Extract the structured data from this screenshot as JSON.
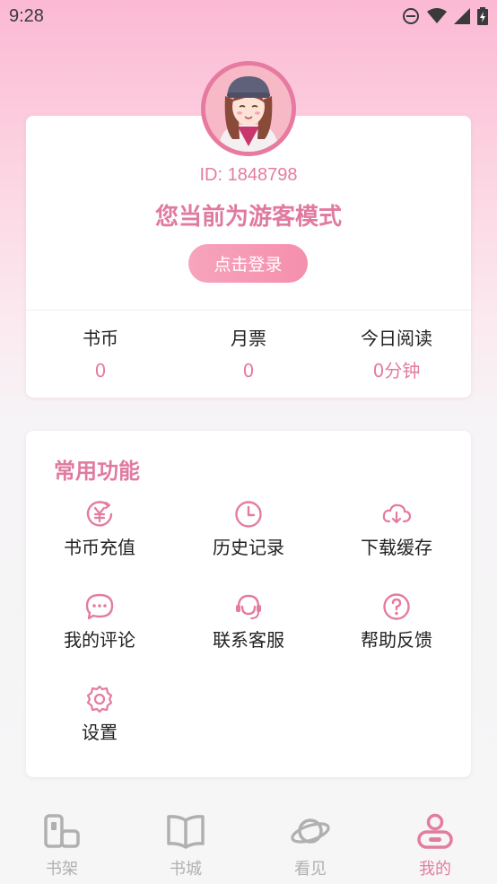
{
  "status_bar": {
    "time": "9:28"
  },
  "profile": {
    "user_id": "ID: 1848798",
    "guest_title": "您当前为游客模式",
    "login_button": "点击登录"
  },
  "stats": [
    {
      "label": "书币",
      "value": "0"
    },
    {
      "label": "月票",
      "value": "0"
    },
    {
      "label": "今日阅读",
      "value": "0分钟"
    }
  ],
  "functions": {
    "title": "常用功能",
    "items": [
      {
        "label": "书币充值",
        "icon": "coin-recharge-icon"
      },
      {
        "label": "历史记录",
        "icon": "clock-icon"
      },
      {
        "label": "下载缓存",
        "icon": "cloud-download-icon"
      },
      {
        "label": "我的评论",
        "icon": "comment-icon"
      },
      {
        "label": "联系客服",
        "icon": "headset-icon"
      },
      {
        "label": "帮助反馈",
        "icon": "help-icon"
      },
      {
        "label": "设置",
        "icon": "settings-icon"
      }
    ]
  },
  "bottom_nav": [
    {
      "label": "书架",
      "icon": "bookshelf-icon",
      "active": false
    },
    {
      "label": "书城",
      "icon": "book-icon",
      "active": false
    },
    {
      "label": "看见",
      "icon": "planet-icon",
      "active": false
    },
    {
      "label": "我的",
      "icon": "profile-icon",
      "active": true
    }
  ],
  "colors": {
    "accent": "#e47ca0",
    "inactive": "#b0b0b0"
  }
}
